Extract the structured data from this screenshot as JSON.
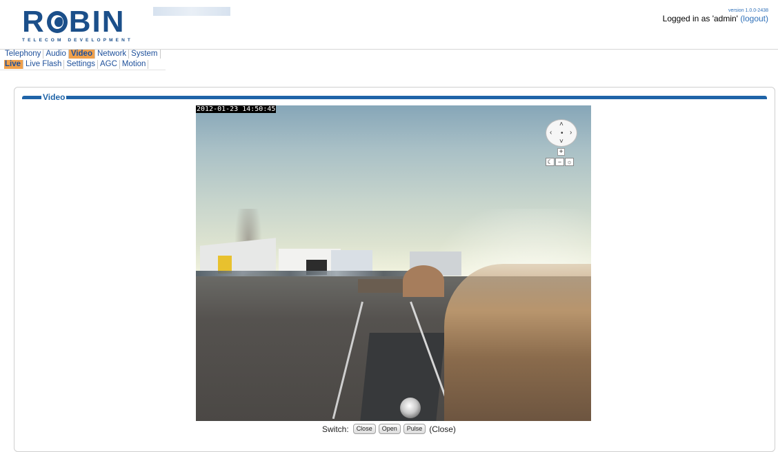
{
  "brand": {
    "name_left": "R",
    "name_right": "BIN",
    "tagline": "TELECOM DEVELOPMENT"
  },
  "header": {
    "version": "version 1.0.0-2438",
    "logged_in_prefix": "Logged in as 'admin'",
    "logout_label": "(logout)"
  },
  "nav": {
    "main": [
      {
        "label": "Telephony",
        "active": false
      },
      {
        "label": "Audio",
        "active": false
      },
      {
        "label": "Video",
        "active": true
      },
      {
        "label": "Network",
        "active": false
      },
      {
        "label": "System",
        "active": false
      }
    ],
    "sub": [
      {
        "label": "Live",
        "active": true
      },
      {
        "label": "Live Flash",
        "active": false
      },
      {
        "label": "Settings",
        "active": false
      },
      {
        "label": "AGC",
        "active": false
      },
      {
        "label": "Motion",
        "active": false
      }
    ]
  },
  "panel": {
    "title": "Video"
  },
  "video": {
    "timestamp": "2012-01-23 14:50:45"
  },
  "ptz": {
    "up_icon": "chevron-up-icon",
    "down_icon": "chevron-down-icon",
    "left_icon": "chevron-left-icon",
    "right_icon": "chevron-right-icon",
    "zoom_in_label": "+",
    "brightness_down_label": "☾",
    "brightness_reset_label": "−",
    "brightness_up_label": "☼"
  },
  "switch": {
    "label": "Switch:",
    "buttons": [
      "Close",
      "Open",
      "Pulse"
    ],
    "state": "(Close)"
  },
  "colors": {
    "brand_blue": "#1b4f8a",
    "link_blue": "#1d4f9a",
    "active_tab": "#f0a04b",
    "panel_blue": "#1f64a8"
  }
}
